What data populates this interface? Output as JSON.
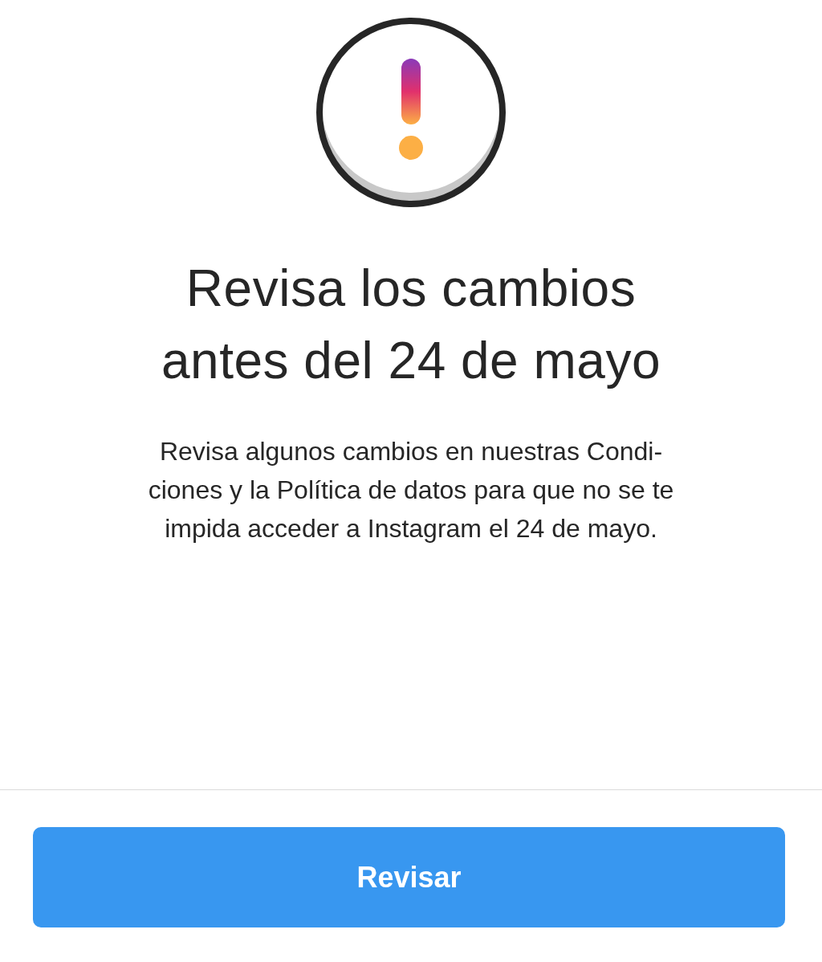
{
  "title": "Revisa los cambios\nantes del 24 de mayo",
  "message": "Revisa algunos cambios en nuestras Condi-\nciones y la Política de datos para que no se te\nimpida acceder a Instagram el 24 de mayo.",
  "button": {
    "label": "Revisar"
  }
}
